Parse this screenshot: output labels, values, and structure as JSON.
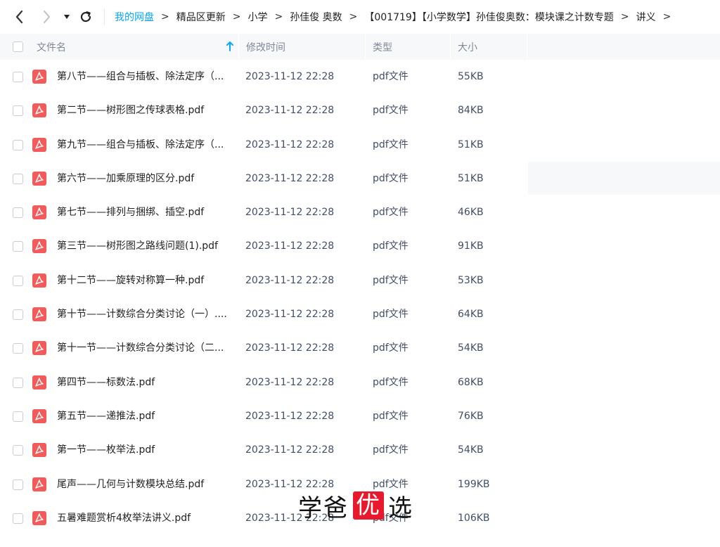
{
  "breadcrumb": [
    "我的网盘",
    "精品区更新",
    "小学",
    "孙佳俊 奥数",
    "【001719】【小学数学】孙佳俊奥数：模块课之计数专题",
    "讲义"
  ],
  "header": {
    "name": "文件名",
    "time": "修改时间",
    "type": "类型",
    "size": "大小"
  },
  "files": [
    {
      "name": "第八节——组合与插板、除法定序（...",
      "time": "2023-11-12 22:28",
      "type": "pdf文件",
      "size": "55KB"
    },
    {
      "name": "第二节——树形图之传球表格.pdf",
      "time": "2023-11-12 22:28",
      "type": "pdf文件",
      "size": "84KB"
    },
    {
      "name": "第九节——组合与插板、除法定序（...",
      "time": "2023-11-12 22:28",
      "type": "pdf文件",
      "size": "51KB"
    },
    {
      "name": "第六节——加乘原理的区分.pdf",
      "time": "2023-11-12 22:28",
      "type": "pdf文件",
      "size": "51KB"
    },
    {
      "name": "第七节——排列与捆绑、插空.pdf",
      "time": "2023-11-12 22:28",
      "type": "pdf文件",
      "size": "46KB"
    },
    {
      "name": "第三节——树形图之路线问题(1).pdf",
      "time": "2023-11-12 22:28",
      "type": "pdf文件",
      "size": "91KB"
    },
    {
      "name": "第十二节——旋转对称算一种.pdf",
      "time": "2023-11-12 22:28",
      "type": "pdf文件",
      "size": "53KB"
    },
    {
      "name": "第十节——计数综合分类讨论（一）....",
      "time": "2023-11-12 22:28",
      "type": "pdf文件",
      "size": "64KB"
    },
    {
      "name": "第十一节——计数综合分类讨论（二...",
      "time": "2023-11-12 22:28",
      "type": "pdf文件",
      "size": "54KB"
    },
    {
      "name": "第四节——标数法.pdf",
      "time": "2023-11-12 22:28",
      "type": "pdf文件",
      "size": "68KB"
    },
    {
      "name": "第五节——递推法.pdf",
      "time": "2023-11-12 22:28",
      "type": "pdf文件",
      "size": "76KB"
    },
    {
      "name": "第一节——枚举法.pdf",
      "time": "2023-11-12 22:28",
      "type": "pdf文件",
      "size": "54KB"
    },
    {
      "name": "尾声——几何与计数模块总结.pdf",
      "time": "2023-11-12 22:28",
      "type": "pdf文件",
      "size": "199KB"
    },
    {
      "name": "五暑难题赏析4枚举法讲义.pdf",
      "time": "2023-11-12 22:28",
      "type": "pdf文件",
      "size": "106KB"
    }
  ],
  "watermark": {
    "part1": "学爸",
    "part2": "优",
    "part3": "选"
  },
  "icons": {
    "back": "chevron-left-icon",
    "forward": "chevron-right-icon",
    "dropdown": "caret-down-icon",
    "refresh": "refresh-icon",
    "sort": "sort-up-arrow-icon",
    "file": "pdf-file-icon"
  },
  "colors": {
    "accent": "#06a7ff",
    "pdf": "#f35b5b",
    "header_bg": "#f7f8fa"
  }
}
